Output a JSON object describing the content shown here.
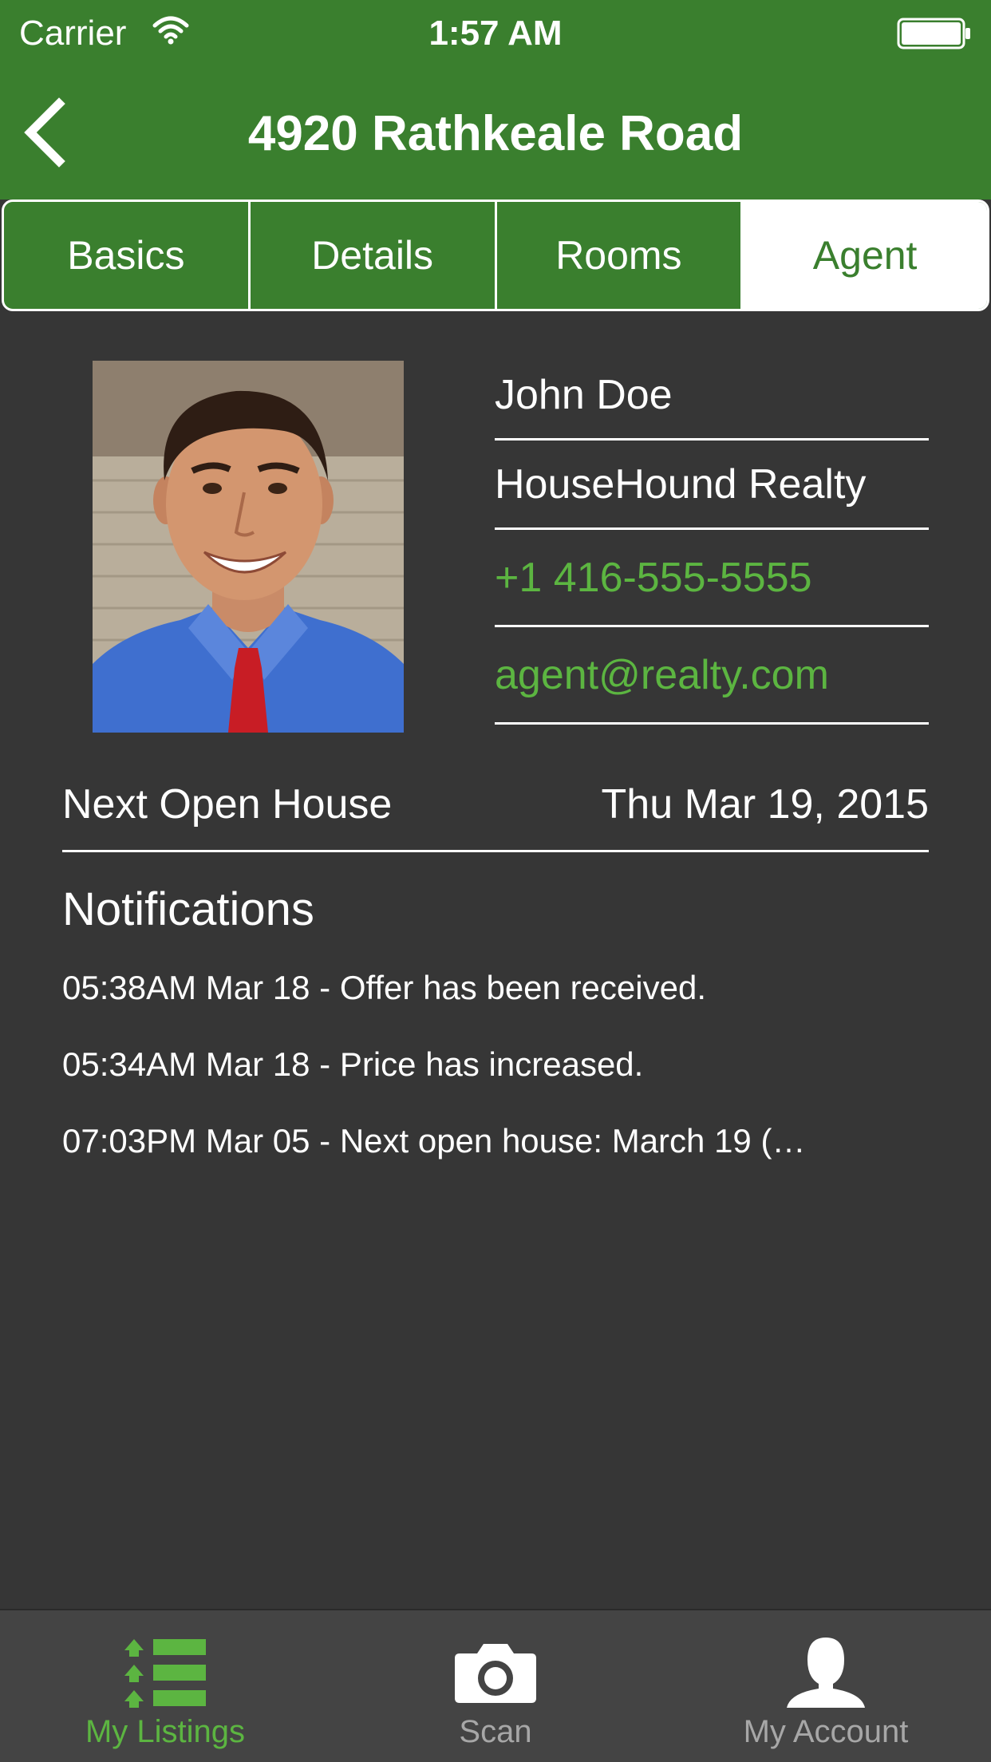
{
  "status_bar": {
    "carrier": "Carrier",
    "time": "1:57 AM"
  },
  "nav": {
    "title": "4920 Rathkeale Road"
  },
  "segments": [
    {
      "label": "Basics",
      "active": false
    },
    {
      "label": "Details",
      "active": false
    },
    {
      "label": "Rooms",
      "active": false
    },
    {
      "label": "Agent",
      "active": true
    }
  ],
  "agent": {
    "name": "John Doe",
    "company": "HouseHound Realty",
    "phone": "+1 416-555-5555",
    "email": "agent@realty.com"
  },
  "open_house": {
    "label": "Next Open House",
    "date": "Thu Mar 19, 2015"
  },
  "notifications": {
    "title": "Notifications",
    "items": [
      "05:38AM Mar 18 - Offer has been received.",
      "05:34AM Mar 18 - Price has increased.",
      "07:03PM Mar 05 - Next open house: March 19 (…"
    ]
  },
  "tab_bar": {
    "tabs": [
      {
        "label": "My Listings",
        "icon": "listings-icon",
        "active": true
      },
      {
        "label": "Scan",
        "icon": "camera-icon",
        "active": false
      },
      {
        "label": "My Account",
        "icon": "person-icon",
        "active": false
      }
    ]
  },
  "colors": {
    "brand_green": "#3a7f2e",
    "accent_green": "#5cb541",
    "background": "#363636",
    "tab_bar": "#444444"
  }
}
